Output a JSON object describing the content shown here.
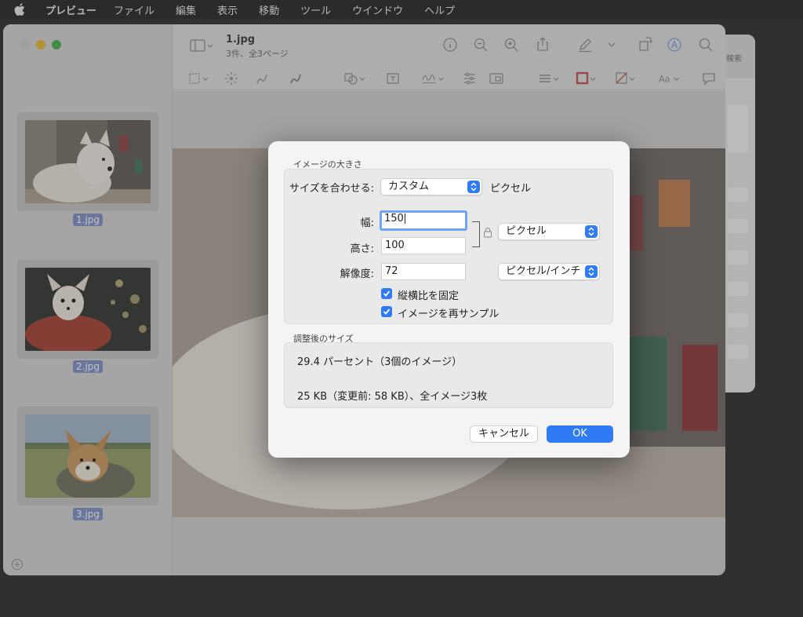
{
  "menubar": {
    "app": "プレビュー",
    "items": [
      "ファイル",
      "編集",
      "表示",
      "移動",
      "ツール",
      "ウインドウ",
      "ヘルプ"
    ]
  },
  "window": {
    "title": "1.jpg",
    "subtitle": "3件、全3ページ"
  },
  "background_window": {
    "search": "検索"
  },
  "sidebar": {
    "thumbnails": [
      {
        "label": "1.jpg"
      },
      {
        "label": "2.jpg"
      },
      {
        "label": "3.jpg"
      }
    ]
  },
  "dialog": {
    "image_size_title": "イメージの大きさ",
    "fit_label": "サイズを合わせる:",
    "fit_value": "カスタム",
    "fit_unit": "ピクセル",
    "width_label": "幅:",
    "width_value": "150",
    "height_label": "高さ:",
    "height_value": "100",
    "size_unit": "ピクセル",
    "resolution_label": "解像度:",
    "resolution_value": "72",
    "resolution_unit": "ピクセル/インチ",
    "scale_proportionally": "縦横比を固定",
    "resample": "イメージを再サンプル",
    "result_title": "調整後のサイズ",
    "result_percent": "29.4 パーセント（3個のイメージ）",
    "result_size": "25 KB（変更前: 58 KB）、全イメージ3枚",
    "cancel": "キャンセル",
    "ok": "OK"
  },
  "colors": {
    "accent": "#2f7bf5",
    "selection": "#7e8cc5"
  }
}
